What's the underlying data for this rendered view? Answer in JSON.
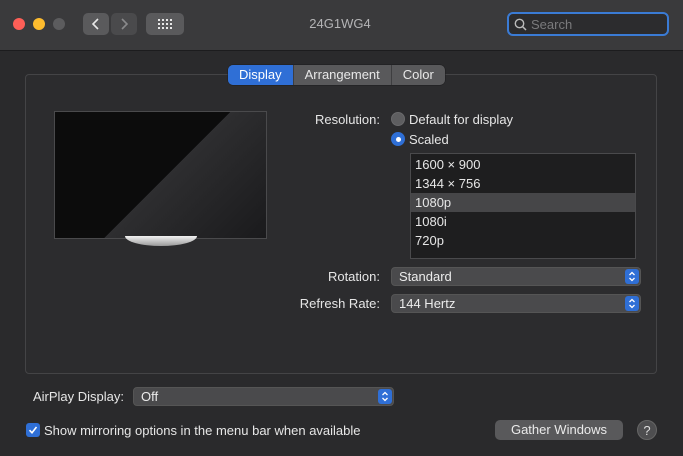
{
  "window": {
    "title": "24G1WG4"
  },
  "search": {
    "placeholder": "Search"
  },
  "tabs": [
    {
      "label": "Display",
      "active": true
    },
    {
      "label": "Arrangement",
      "active": false
    },
    {
      "label": "Color",
      "active": false
    }
  ],
  "resolution": {
    "label": "Resolution:",
    "options": [
      {
        "label": "Default for display",
        "selected": false
      },
      {
        "label": "Scaled",
        "selected": true
      }
    ],
    "list": [
      "1600 × 900",
      "1344 × 756",
      "1080p",
      "1080i",
      "720p"
    ],
    "list_selected": "1080p"
  },
  "rotation": {
    "label": "Rotation:",
    "value": "Standard"
  },
  "refresh": {
    "label": "Refresh Rate:",
    "value": "144 Hertz"
  },
  "airplay": {
    "label": "AirPlay Display:",
    "value": "Off"
  },
  "mirroring": {
    "label": "Show mirroring options in the menu bar when available",
    "checked": true
  },
  "gather_button": {
    "label": "Gather Windows"
  },
  "help": {
    "label": "?"
  },
  "colors": {
    "accent": "#2f6fd6",
    "window_bg": "#2a2a2c",
    "titlebar_bg": "#3a3a3c"
  },
  "icons": [
    "chevron-left-icon",
    "chevron-right-icon",
    "grid-icon",
    "search-icon",
    "chevron-updown-icon",
    "checkmark-icon"
  ]
}
